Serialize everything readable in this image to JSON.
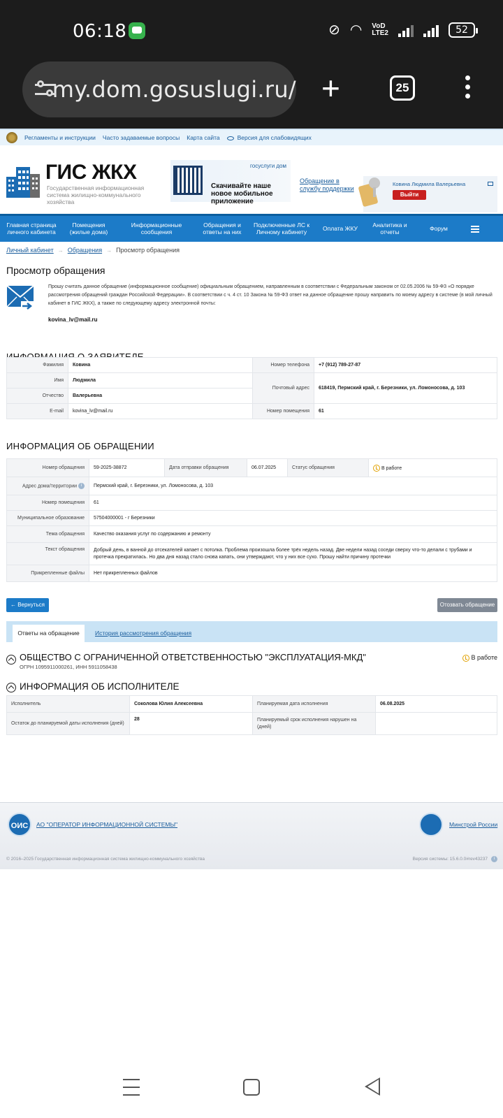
{
  "status_bar": {
    "time": "06:18",
    "battery": "52"
  },
  "browser": {
    "url": "my.dom.gosuslugi.ru/",
    "tabs_count": "25"
  },
  "topbar": {
    "links": [
      "Регламенты и инструкции",
      "Часто задаваемые вопросы",
      "Карта сайта",
      "Версия для слабовидящих"
    ]
  },
  "header": {
    "title": "ГИС ЖКХ",
    "subtitle": "Государственная информационная система жилищно-коммунального хозяйства",
    "promo_brand": "госуслуги дом",
    "promo_text": "Скачивайте наше новое мобильное приложение",
    "support_link": "Обращение в службу поддержки",
    "user_name": "Ковина Людмила Валерьевна",
    "logout": "Выйти"
  },
  "nav": {
    "items": [
      "Главная страница личного кабинета",
      "Помещения (жилые дома)",
      "Информационные сообщения",
      "Обращения и ответы на них",
      "Подключенные ЛС к Личному кабинету",
      "Оплата ЖКУ",
      "Аналитика и отчеты",
      "Форум"
    ]
  },
  "breadcrumb": [
    "Личный кабинет",
    "Обращения",
    "Просмотр обращения"
  ],
  "page_title": "Просмотр обращения",
  "intro": {
    "text": "Прошу считать данное обращение (информационное сообщение) официальным обращением, направленным в соответствии с Федеральным законом от 02.05.2006 № 59-ФЗ «О порядке рассмотрения обращений граждан Российской Федерации». В соответствии с ч. 4 ст. 10 Закона № 59-ФЗ ответ на данное обращение прошу направить по моему адресу в системе (в мой личный кабинет в ГИС ЖКХ), а также по следующему адресу электронной почты:",
    "email": "kovina_lv@mail.ru"
  },
  "applicant": {
    "heading": "ИНФОРМАЦИЯ О ЗАЯВИТЕЛЕ",
    "last_name_label": "Фамилия",
    "last_name": "Ковина",
    "first_name_label": "Имя",
    "first_name": "Людмила",
    "patronymic_label": "Отчество",
    "patronymic": "Валерьевна",
    "email_label": "E-mail",
    "email": "kovina_lv@mail.ru",
    "phone_label": "Номер телефона",
    "phone": "+7 (912) 789-27-87",
    "address_label": "Почтовый адрес",
    "address": "618419, Пермский край, г. Березники, ул. Ломоносова, д. 103",
    "room_label": "Номер помещения",
    "room": "61"
  },
  "appeal": {
    "heading": "ИНФОРМАЦИЯ ОБ ОБРАЩЕНИИ",
    "number_label": "Номер обращения",
    "number": "59-2025-38872",
    "date_label": "Дата отправки обращения",
    "date": "06.07.2025",
    "status_label": "Статус обращения",
    "status": "В работе",
    "address_label": "Адрес дома/территории",
    "address": "Пермский край, г. Березники, ул. Ломоносова, д. 103",
    "room_label": "Номер помещения",
    "room": "61",
    "municipality_label": "Муниципальное образование",
    "municipality": "57504000001 - г Березники",
    "topic_label": "Тема обращения",
    "topic": "Качество оказания услуг по содержанию и ремонту",
    "text_label": "Текст обращения",
    "text": "Добрый день, в ванной до отсекателей капает с потолка. Проблема произошла более трёх недель назад. Две недели назад соседи сверху что-то делали с трубами и протечка прекратилась. Но два дня назад стало снова капать, они утверждают, что у них все сухо. Прошу найти причину протечки",
    "files_label": "Прикрепленные файлы",
    "files": "Нет прикрепленных файлов"
  },
  "actions": {
    "back": "← Вернуться",
    "revoke": "Отозвать обращение"
  },
  "tabs": {
    "active": "Ответы на обращение",
    "history": "История рассмотрения обращения"
  },
  "organization": {
    "name": "ОБЩЕСТВО С ОГРАНИЧЕННОЙ ОТВЕТСТВЕННОСТЬЮ \"ЭКСПЛУАТАЦИЯ-МКД\"",
    "ids": "ОГРН 1095911000261, ИНН 5911058438",
    "status": "В работе"
  },
  "executor": {
    "heading": "ИНФОРМАЦИЯ ОБ ИСПОЛНИТЕЛЕ",
    "executor_label": "Исполнитель",
    "executor": "Соколова Юлия Алексеевна",
    "planned_date_label": "Планируемая дата исполнения",
    "planned_date": "06.08.2025",
    "remaining_label": "Остаток до планируемой даты исполнения (дней)",
    "remaining": "28",
    "violated_label": "Планируемый срок исполнения нарушен на (дней)",
    "violated": ""
  },
  "footer": {
    "ois_logo": "ОИС",
    "ois_link": "АО \"ОПЕРАТОР ИНФОРМАЦИОННОЙ СИСТЕМЫ\"",
    "minstroy_link": "Минстрой России",
    "copyright": "© 2016–2025 Государственная информационная система жилищно-коммунального хозяйства",
    "version": "Версия системы: 15.6.0.0#rev43237"
  }
}
